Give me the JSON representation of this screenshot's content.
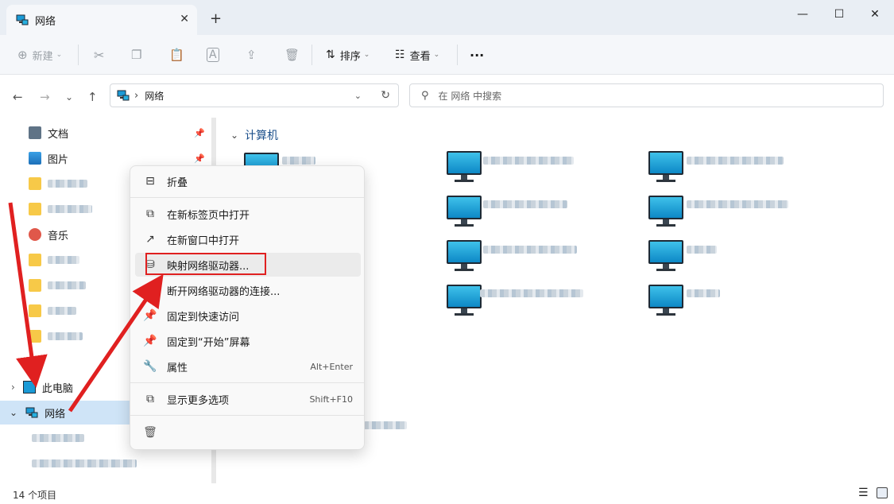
{
  "tab": {
    "title": "网络",
    "close": "✕",
    "new": "+"
  },
  "window": {
    "minimize": "—",
    "maximize": "☐",
    "close": "✕"
  },
  "toolbar": {
    "new_label": "新建",
    "sort_label": "排序",
    "view_label": "查看",
    "more_label": "···"
  },
  "address": {
    "location": "网络",
    "separator": "›"
  },
  "search": {
    "placeholder": "在 网络 中搜索"
  },
  "sidebar": {
    "items": [
      {
        "label": "文档"
      },
      {
        "label": "图片"
      },
      {
        "label": "音乐"
      },
      {
        "label": "此电脑"
      },
      {
        "label": "网络"
      }
    ]
  },
  "content": {
    "group_title": "计算机"
  },
  "context_menu": {
    "items": [
      {
        "label": "折叠",
        "shortcut": ""
      },
      {
        "label": "在新标签页中打开",
        "shortcut": ""
      },
      {
        "label": "在新窗口中打开",
        "shortcut": ""
      },
      {
        "label": "映射网络驱动器...",
        "shortcut": ""
      },
      {
        "label": "断开网络驱动器的连接...",
        "shortcut": ""
      },
      {
        "label": "固定到快速访问",
        "shortcut": ""
      },
      {
        "label": "固定到“开始”屏幕",
        "shortcut": ""
      },
      {
        "label": "属性",
        "shortcut": "Alt+Enter"
      },
      {
        "label": "显示更多选项",
        "shortcut": "Shift+F10"
      }
    ]
  },
  "status": {
    "count": "14 个项目"
  },
  "colors": {
    "accent": "#1b4f8b",
    "selected": "#cfe4f7",
    "arrow": "#e02020"
  }
}
